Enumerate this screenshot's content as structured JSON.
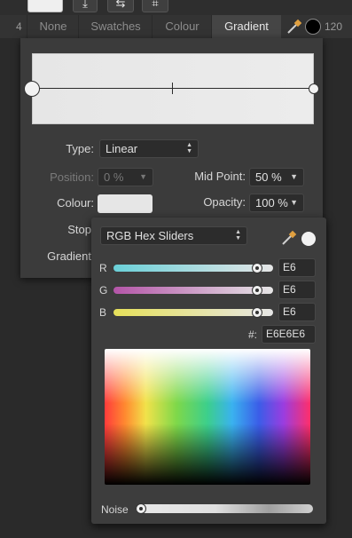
{
  "toolbar": {
    "icons": [
      "colour-well",
      "download-icon",
      "swap-icon",
      "crop-icon"
    ]
  },
  "tabs": {
    "left_number": "4",
    "items": [
      {
        "label": "None"
      },
      {
        "label": "Swatches"
      },
      {
        "label": "Colour"
      },
      {
        "label": "Gradient",
        "active": true
      }
    ],
    "right_number": "120"
  },
  "gradient": {
    "type_label": "Type:",
    "type_value": "Linear",
    "position_label": "Position:",
    "position_value": "0 %",
    "midpoint_label": "Mid Point:",
    "midpoint_value": "50 %",
    "colour_label": "Colour:",
    "opacity_label": "Opacity:",
    "opacity_value": "100 %",
    "stop_label": "Stop",
    "gradient_label": "Gradient",
    "stop_colour": "#E6E6E6"
  },
  "colour_picker": {
    "mode_value": "RGB Hex Sliders",
    "channels": [
      {
        "label": "R",
        "value": "E6",
        "level": 0.9
      },
      {
        "label": "G",
        "value": "E6",
        "level": 0.9
      },
      {
        "label": "B",
        "value": "E6",
        "level": 0.9
      }
    ],
    "hex_label": "#:",
    "hex_value": "E6E6E6",
    "noise_label": "Noise",
    "noise_level": 0.0
  },
  "colors": {
    "panel_bg": "#3b3b3b",
    "accent_swatch": "#e6e6e6"
  }
}
